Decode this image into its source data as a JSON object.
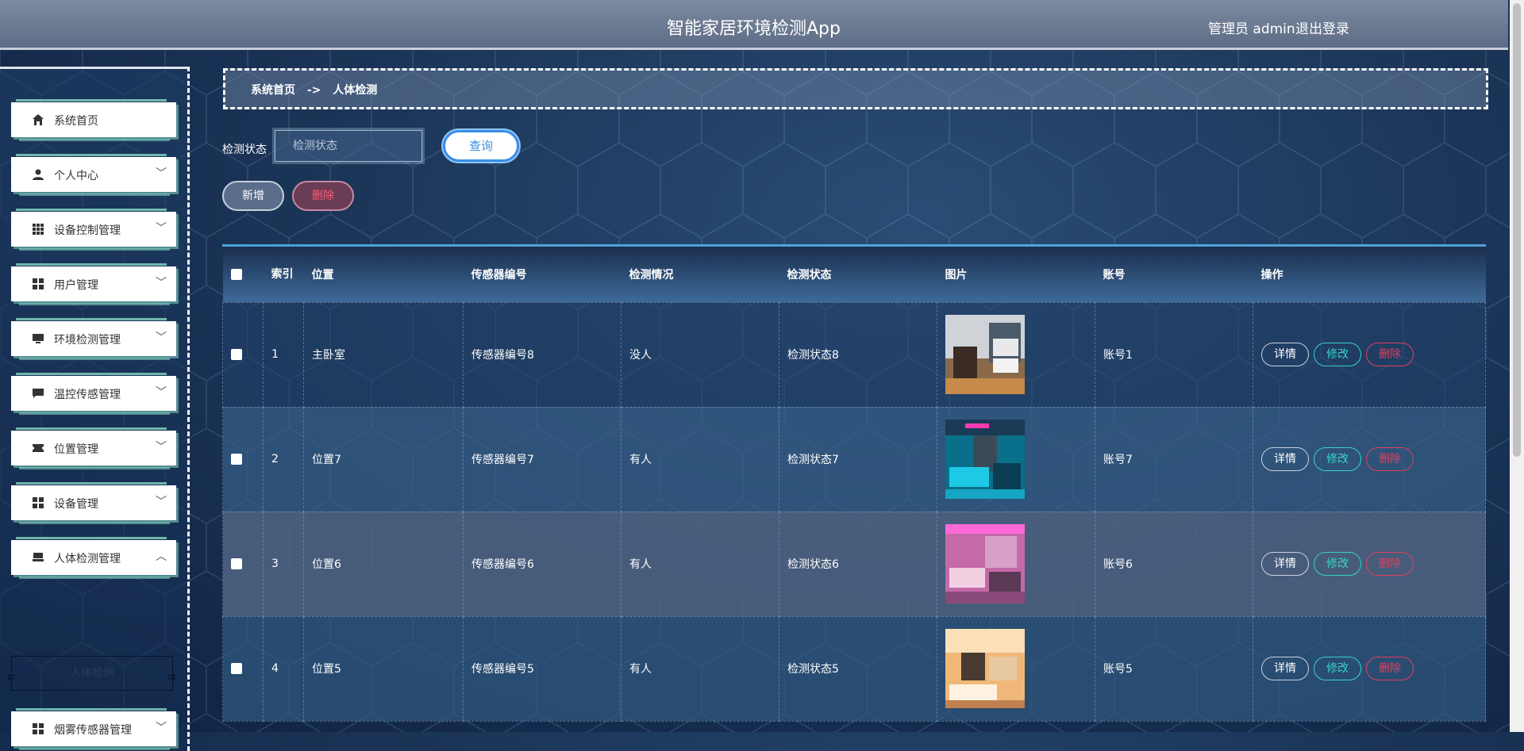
{
  "header": {
    "title": "智能家居环境检测App",
    "user": "管理员 admin",
    "logout": "退出登录"
  },
  "sidebar": {
    "items": [
      {
        "label": "系统首页",
        "icon": "home-icon"
      },
      {
        "label": "个人中心",
        "icon": "person-icon",
        "chevron": "﹀"
      },
      {
        "label": "设备控制管理",
        "icon": "grid-icon",
        "chevron": "﹀"
      },
      {
        "label": "用户管理",
        "icon": "blocks-icon",
        "chevron": "﹀"
      },
      {
        "label": "环境检测管理",
        "icon": "monitor-icon",
        "chevron": "﹀"
      },
      {
        "label": "温控传感管理",
        "icon": "chat-icon",
        "chevron": "﹀"
      },
      {
        "label": "位置管理",
        "icon": "ticket-icon",
        "chevron": "﹀"
      },
      {
        "label": "设备管理",
        "icon": "blocks-icon",
        "chevron": "﹀"
      },
      {
        "label": "人体检测管理",
        "icon": "bed-icon",
        "chevron": "︿"
      },
      {
        "label": "烟雾传感器管理",
        "icon": "blocks-icon",
        "chevron": "﹀"
      }
    ],
    "sub_item": "人体检测"
  },
  "breadcrumb": {
    "home": "系统首页",
    "sep": "->",
    "current": "人体检测"
  },
  "search": {
    "label": "检测状态",
    "placeholder": "检测状态",
    "query_button": "查询"
  },
  "actions": {
    "add": "新增",
    "delete": "删除"
  },
  "table": {
    "headers": [
      "索引",
      "位置",
      "传感器编号",
      "检测情况",
      "检测状态",
      "图片",
      "账号",
      "操作"
    ],
    "rows": [
      {
        "index": "1",
        "location": "主卧室",
        "sensor": "传感器编号8",
        "situation": "没人",
        "status": "检测状态8",
        "account": "账号1"
      },
      {
        "index": "2",
        "location": "位置7",
        "sensor": "传感器编号7",
        "situation": "有人",
        "status": "检测状态7",
        "account": "账号7"
      },
      {
        "index": "3",
        "location": "位置6",
        "sensor": "传感器编号6",
        "situation": "有人",
        "status": "检测状态6",
        "account": "账号6"
      },
      {
        "index": "4",
        "location": "位置5",
        "sensor": "传感器编号5",
        "situation": "有人",
        "status": "检测状态5",
        "account": "账号5"
      }
    ],
    "ops": {
      "detail": "详情",
      "edit": "修改",
      "delete": "删除"
    }
  }
}
